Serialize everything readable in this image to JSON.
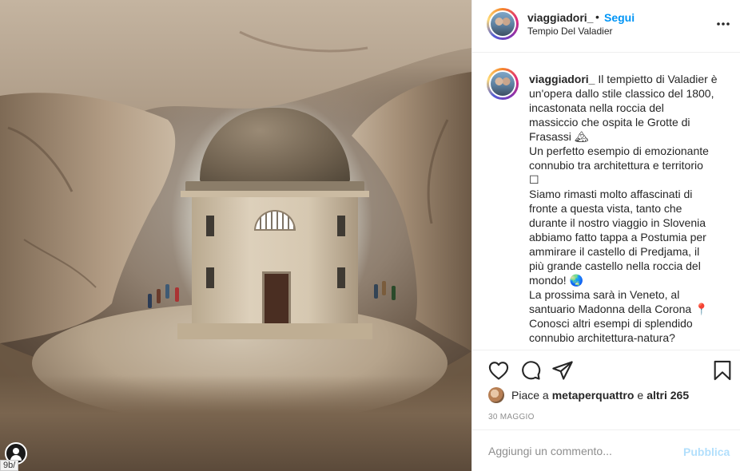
{
  "post": {
    "username": "viaggiadori_",
    "separator": "•",
    "follow_label": "Segui",
    "location": "Tempio Del Valadier",
    "more_icon": "more-horizontal-icon"
  },
  "caption": {
    "username": "viaggiadori_",
    "lines": [
      "Il tempietto di Valadier è",
      "un'opera dallo stile classico del 1800,",
      "incastonata nella roccia del",
      "massiccio che ospita le Grotte di",
      "Frasassi 🏔",
      "Un perfetto esempio di emozionante",
      "connubio tra architettura e territorio",
      "☐",
      "Siamo rimasti molto affascinati di",
      "fronte a questa vista, tanto che",
      "durante il nostro viaggio in Slovenia",
      "abbiamo fatto tappa a Postumia per",
      "ammirare il castello di Predjama, il",
      "più grande castello nella roccia del",
      "mondo! 🌏",
      "La prossima sarà in Veneto, al",
      "santuario Madonna della Corona 📍",
      "Conosci altri esempi di splendido",
      "connubio architettura-natura?"
    ]
  },
  "actions": {
    "like_icon": "heart-icon",
    "comment_icon": "comment-icon",
    "share_icon": "share-icon",
    "save_icon": "bookmark-icon"
  },
  "likes": {
    "prefix": "Piace a",
    "user": "metaperquattro",
    "conjunction": "e",
    "others": "altri 265"
  },
  "date": "30 MAGGIO",
  "comment": {
    "placeholder": "Aggiungi un commento...",
    "publish_label": "Pubblica"
  },
  "status_url": "9b/",
  "colors": {
    "accent": "#0095f6",
    "publish_disabled": "#b2dffc",
    "muted": "#8e8e8e",
    "text": "#262626"
  }
}
